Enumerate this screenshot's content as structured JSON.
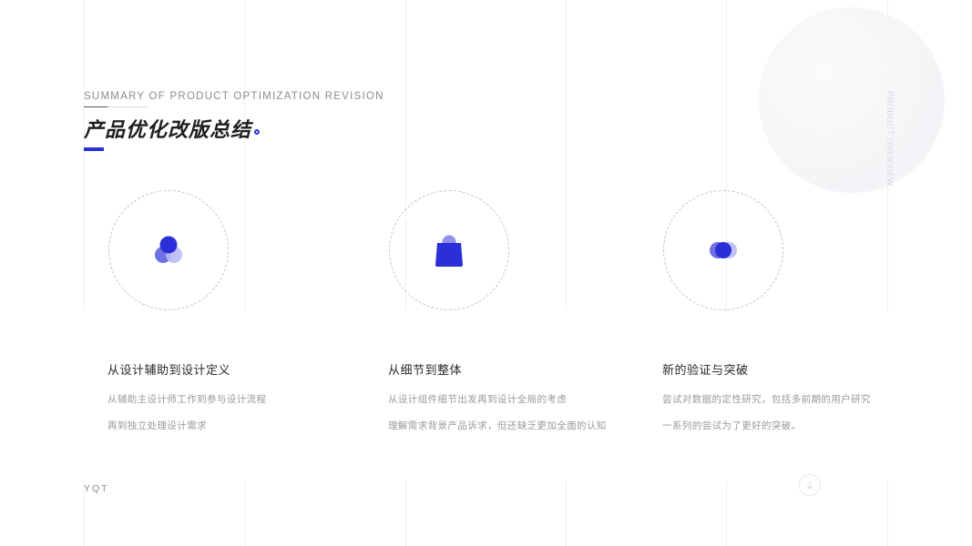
{
  "header": {
    "subtitle": "SUMMARY OF PRODUCT OPTIMIZATION REVISION",
    "title": "产品优化改版总结"
  },
  "side_label": "PRODUCT OVERVIEW",
  "accent_color": "#2b2fd8",
  "cards": [
    {
      "icon": "three-circles-icon",
      "title": "从设计辅助到设计定义",
      "lines": [
        "从辅助主设计师工作到参与设计流程",
        "再到独立处理设计需求"
      ]
    },
    {
      "icon": "shopping-bag-icon",
      "title": "从细节到整体",
      "lines": [
        "从设计组件细节出发再到设计全局的考虑",
        "理解需求背景产品诉求，但还缺乏更加全面的认知"
      ]
    },
    {
      "icon": "overlapping-circles-icon",
      "title": "新的验证与突破",
      "lines": [
        "尝试对数据的定性研究，包括多前期的用户研究",
        "一系列的尝试为了更好的突破。"
      ]
    }
  ],
  "footer": {
    "brand": "YQT",
    "scroll_icon": "arrow-down-icon"
  }
}
